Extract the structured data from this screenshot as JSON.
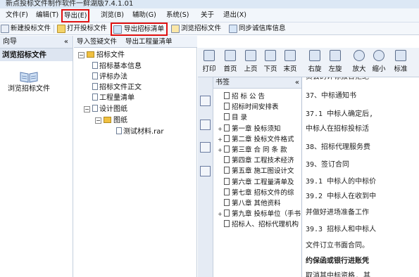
{
  "window": {
    "title": "新点投标文件制作软件一鲜湖版7.4.1.01"
  },
  "menu": [
    {
      "label": "文件(F)"
    },
    {
      "label": "编辑(T)"
    },
    {
      "label": "导出(E)",
      "highlighted": true
    },
    {
      "label": "浏览(B)"
    },
    {
      "label": "辅助(G)"
    },
    {
      "label": "系统(S)"
    },
    {
      "label": "关于"
    },
    {
      "label": "退出(X)"
    }
  ],
  "toolbar": {
    "new_bid": "新建投标文件",
    "open_bid": "打开投标文件",
    "export_tender": "导出招标清单",
    "browse_tender": "浏览招标文件",
    "sync_integrity": "同步诚信库信息"
  },
  "left_panel": {
    "header": "向导",
    "section_title": "浏览招标文件",
    "item_label": "浏览招标文件"
  },
  "nav_tabs": [
    "导入签疑文件",
    "导出工程量清单"
  ],
  "tree": {
    "root": "招标文件",
    "children": [
      "招标基本信息",
      "评标办法",
      "招标文件正文",
      "工程量清单"
    ],
    "drawings": "设计图纸",
    "sub_folder": "图纸",
    "file": "测试材料.rar"
  },
  "viewer_toolbar": [
    {
      "label": "打印",
      "icon": "print-icon"
    },
    {
      "label": "首页",
      "icon": "first-page-icon"
    },
    {
      "label": "上页",
      "icon": "prev-page-icon"
    },
    {
      "label": "下页",
      "icon": "next-page-icon"
    },
    {
      "label": "末页",
      "icon": "last-page-icon"
    },
    {
      "label": "右旋",
      "icon": "rotate-right-icon"
    },
    {
      "label": "左旋",
      "icon": "rotate-left-icon"
    },
    {
      "label": "放大",
      "icon": "zoom-in-icon"
    },
    {
      "label": "缩小",
      "icon": "zoom-out-icon"
    },
    {
      "label": "标准",
      "icon": "standard-size-icon"
    }
  ],
  "bookmarks": {
    "header": "书签",
    "items": [
      {
        "label": "招 标 公 告",
        "expand": ""
      },
      {
        "label": "招标时间安排表",
        "expand": ""
      },
      {
        "label": "目  录",
        "expand": ""
      },
      {
        "label": "第一章  投标须知",
        "expand": "+"
      },
      {
        "label": "第二章  投标文件格式",
        "expand": "+"
      },
      {
        "label": "第三章  合 同 条 款",
        "expand": "+"
      },
      {
        "label": "第四章  工程技术经济",
        "expand": ""
      },
      {
        "label": "第五章  施工图设计文",
        "expand": ""
      },
      {
        "label": "第六章  工程量清单及",
        "expand": ""
      },
      {
        "label": "第七章    招标文件的综",
        "expand": ""
      },
      {
        "label": "第八章    其他资料",
        "expand": ""
      },
      {
        "label": "第九章  投标单位（手书",
        "expand": "+"
      },
      {
        "label": "招标人、招标代理机构",
        "expand": ""
      }
    ]
  },
  "document": {
    "lines": [
      "员会的评标报告拒绝",
      "37、中标通知书",
      "37.1 中标人确定后,",
      "中标人在招标投标活",
      "38、招标代理服务费",
      "39、签订合同",
      "39.1 中标人的中标价",
      "39.2 中标人在收到中",
      "并做好进场准备工作",
      "39.3 招标人和中标人",
      "文件订立书面合同。",
      "约保函或银行进账凭",
      "取消其中标资格, 其"
    ]
  }
}
